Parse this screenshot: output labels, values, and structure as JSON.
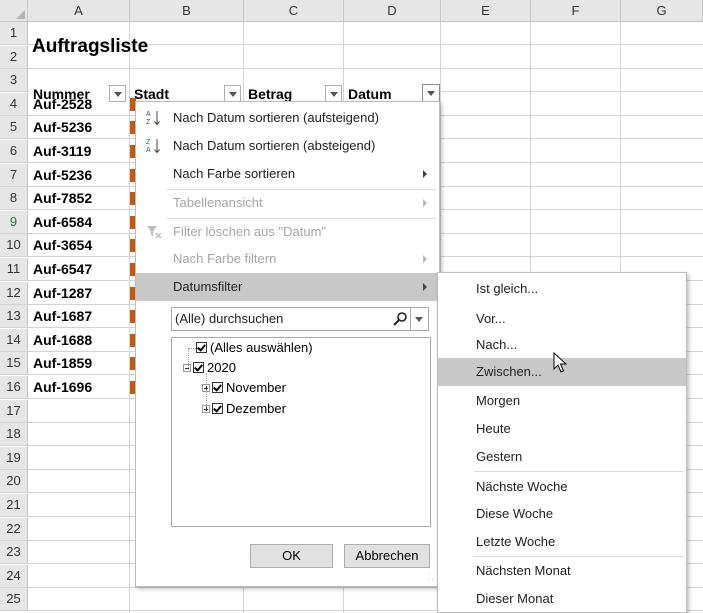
{
  "columns": [
    "A",
    "B",
    "C",
    "D",
    "E",
    "F",
    "G"
  ],
  "rows": [
    "1",
    "2",
    "3",
    "4",
    "5",
    "6",
    "7",
    "8",
    "9",
    "10",
    "11",
    "12",
    "13",
    "14",
    "15",
    "16",
    "17",
    "18",
    "19",
    "20",
    "21",
    "22",
    "23",
    "24",
    "25"
  ],
  "title": "Auftragsliste",
  "headers": {
    "nummer": "Nummer",
    "stadt": "Stadt",
    "betrag": "Betrag",
    "datum": "Datum"
  },
  "nummern": [
    "Auf-2528",
    "Auf-5236",
    "Auf-3119",
    "Auf-5236",
    "Auf-7852",
    "Auf-6584",
    "Auf-3654",
    "Auf-6547",
    "Auf-1287",
    "Auf-1687",
    "Auf-1688",
    "Auf-1859",
    "Auf-1696"
  ],
  "menu": {
    "sort_asc": "Nach Datum sortieren (aufsteigend)",
    "sort_desc": "Nach Datum sortieren (absteigend)",
    "sort_color": "Nach Farbe sortieren",
    "table_view": "Tabellenansicht",
    "clear_filter": "Filter löschen aus \"Datum\"",
    "filter_color": "Nach Farbe filtern",
    "date_filter": "Datumsfilter",
    "search_placeholder": "(Alle) durchsuchen",
    "tree": {
      "select_all": "(Alles auswählen)",
      "year": "2020",
      "month1": "November",
      "month2": "Dezember"
    },
    "ok": "OK",
    "cancel": "Abbrechen"
  },
  "submenu": [
    "Ist gleich...",
    "Vor...",
    "Nach...",
    "Zwischen...",
    "Morgen",
    "Heute",
    "Gestern",
    "Nächste Woche",
    "Diese Woche",
    "Letzte Woche",
    "Nächsten Monat",
    "Dieser Monat"
  ],
  "colors": {
    "accent_green": "#217346",
    "highlight": "#c8c8c8",
    "cell_stub": "#c55a11"
  }
}
